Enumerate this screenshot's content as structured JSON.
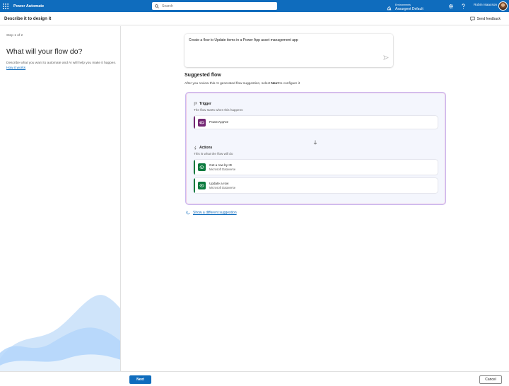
{
  "topbar": {
    "app_name": "Power Automate",
    "search_placeholder": "Search",
    "environment_label": "Environments",
    "environment_value": "Assurgent Default",
    "user_name": "Robin Isaacson"
  },
  "header": {
    "title": "Describe it to design it",
    "feedback_label": "Send feedback"
  },
  "left_panel": {
    "step": "Step 1 of 2",
    "heading": "What will your flow do?",
    "description": "Describe what you want to automate and AI will help you make it happen.",
    "link": "How it works"
  },
  "prompt": {
    "text": "Create a flow to Update items in a Power App asset management app"
  },
  "suggestion": {
    "heading": "Suggested flow",
    "subtitle_before": "After you review this AI generated flow suggestion, select ",
    "subtitle_bold": "Next",
    "subtitle_after": " to configure it",
    "trigger_title": "Trigger",
    "trigger_sub": "The flow starts when this happens",
    "trigger_step": {
      "name": "PowerAppV2",
      "color": "#742774"
    },
    "actions_title": "Actions",
    "actions_sub": "This is what the flow will do",
    "actions": [
      {
        "name": "Get a row by ID",
        "connector": "Microsoft Dataverse",
        "color": "#0b7a3e"
      },
      {
        "name": "Update a row",
        "connector": "Microsoft Dataverse",
        "color": "#0b7a3e"
      }
    ],
    "alternate_link": "Show a different suggestion"
  },
  "footer": {
    "next_label": "Next",
    "cancel_label": "Cancel"
  },
  "colors": {
    "brand": "#0f6cbd",
    "trigger_accent": "#742774",
    "action_accent": "#0b7a3e"
  }
}
